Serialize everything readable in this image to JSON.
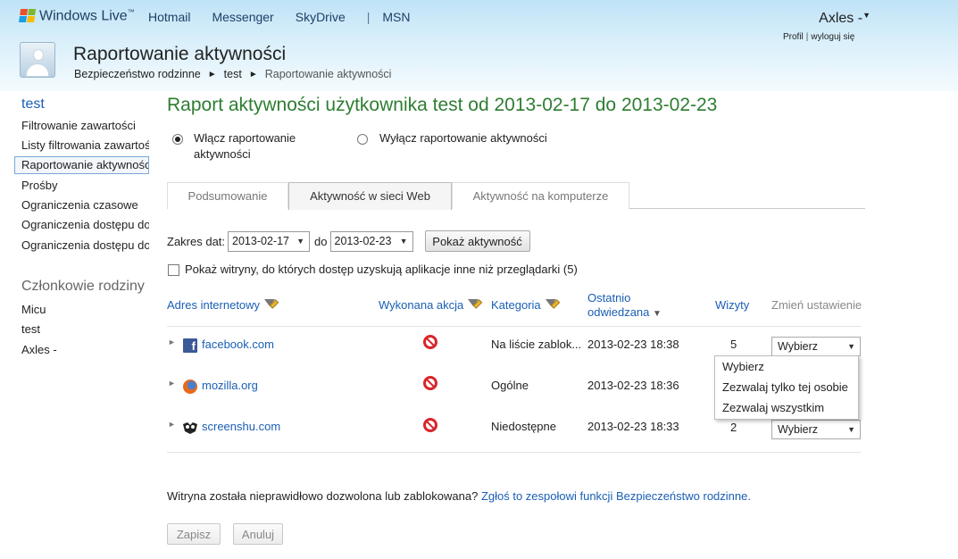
{
  "header": {
    "brand": "Windows Live",
    "nav": [
      "Hotmail",
      "Messenger",
      "SkyDrive",
      "|",
      "MSN"
    ],
    "user_name": "Axles -",
    "profile_link": "Profil",
    "link_separator": "|",
    "logout_link": "wyloguj się",
    "page_title": "Raportowanie aktywności",
    "breadcrumb": [
      "Bezpieczeństwo rodzinne",
      "test",
      "Raportowanie aktywności"
    ]
  },
  "sidebar": {
    "account": "test",
    "items": [
      "Filtrowanie zawartości",
      "Listy filtrowania zawartości",
      "Raportowanie aktywności",
      "Prośby",
      "Ograniczenia czasowe",
      "Ograniczenia dostępu do gier",
      "Ograniczenia dostępu do aplikacji"
    ],
    "members_heading": "Członkowie rodziny",
    "members": [
      "Micu",
      "test",
      "Axles -"
    ]
  },
  "main": {
    "title": "Raport aktywności użytkownika test od 2013-02-17 do 2013-02-23",
    "radio_on": {
      "line1": "Włącz raportowanie",
      "line2": "aktywności",
      "selected": true
    },
    "radio_off": {
      "label": "Wyłącz raportowanie aktywności",
      "selected": false
    },
    "tabs": [
      "Podsumowanie",
      "Aktywność w sieci Web",
      "Aktywność na komputerze"
    ],
    "active_tab": 1,
    "date_range_label": "Zakres dat:",
    "date_from": "2013-02-17",
    "date_to_label": "do",
    "date_to": "2013-02-23",
    "show_button": "Pokaż aktywność",
    "checkbox_label": "Pokaż witryny, do których dostęp uzyskują aplikacje inne niż przeglądarki (5)",
    "columns": {
      "address": "Adres internetowy",
      "action": "Wykonana akcja",
      "category": "Kategoria",
      "last_visit_line1": "Ostatnio",
      "last_visit_line2": "odwiedzana",
      "sort_indicator": "▼",
      "visits": "Wizyty",
      "change": "Zmień ustawienie"
    },
    "rows": [
      {
        "site": "facebook.com",
        "favicon": "facebook-icon",
        "category": "Na liście zablokowanych",
        "category_display": "Na liście zablok...",
        "last_visit": "2013-02-23 18:38",
        "visits": "5",
        "setting": "Wybierz"
      },
      {
        "site": "mozilla.org",
        "favicon": "firefox-icon",
        "category": "Ogólne",
        "category_display": "Ogólne",
        "last_visit": "2013-02-23 18:36",
        "visits": "",
        "setting": "Wybierz"
      },
      {
        "site": "screenshu.com",
        "favicon": "screenshu-icon",
        "category": "Niedostępne",
        "category_display": "Niedostępne",
        "last_visit": "2013-02-23 18:33",
        "visits": "2",
        "setting": "Wybierz"
      }
    ],
    "dropdown_options": [
      "Wybierz",
      "Zezwalaj tylko tej osobie",
      "Zezwalaj wszystkim"
    ],
    "footer_question": "Witryna została nieprawidłowo dozwolona lub zablokowana?",
    "footer_link": "Zgłoś to zespołowi funkcji Bezpieczeństwo rodzinne.",
    "save_button": "Zapisz",
    "cancel_button": "Anuluj"
  },
  "colors": {
    "title_green": "#2e7d32",
    "link_blue": "#1a5fb4",
    "block_red": "#d7262b"
  }
}
